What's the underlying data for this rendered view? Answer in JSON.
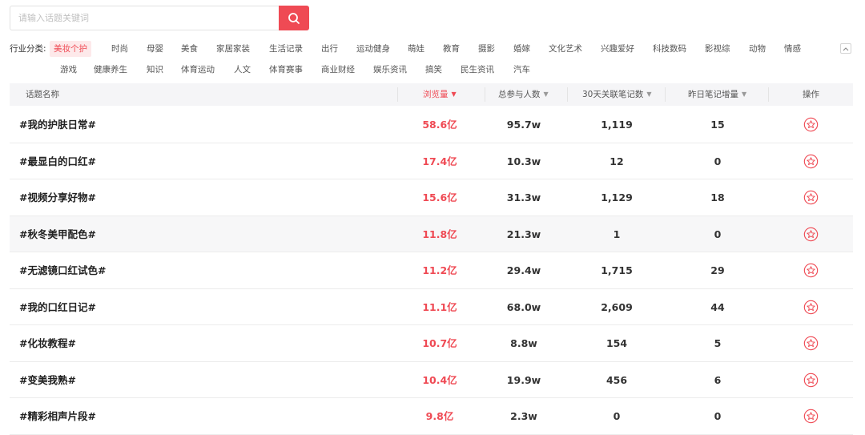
{
  "search": {
    "placeholder": "请输入话题关键词",
    "icon": "search-icon"
  },
  "categories": {
    "label": "行业分类:",
    "row1": [
      "美妆个护",
      "时尚",
      "母婴",
      "美食",
      "家居家装",
      "生活记录",
      "出行",
      "运动健身",
      "萌娃",
      "教育",
      "摄影",
      "婚嫁",
      "文化艺术",
      "兴趣爱好",
      "科技数码",
      "影视综",
      "动物",
      "情感"
    ],
    "row2": [
      "游戏",
      "健康养生",
      "知识",
      "体育运动",
      "人文",
      "体育赛事",
      "商业财经",
      "娱乐资讯",
      "搞笑",
      "民生资讯",
      "汽车"
    ],
    "active": "美妆个护"
  },
  "table": {
    "headers": {
      "name": "话题名称",
      "views": "浏览量",
      "participants": "总参与人数",
      "notes30": "30天关联笔记数",
      "yesterday": "昨日笔记增量",
      "action": "操作"
    },
    "rows": [
      {
        "name": "#我的护肤日常#",
        "views": "58.6亿",
        "participants": "95.7w",
        "notes30": "1,119",
        "yesterday": "15"
      },
      {
        "name": "#最显白的口红#",
        "views": "17.4亿",
        "participants": "10.3w",
        "notes30": "12",
        "yesterday": "0"
      },
      {
        "name": "#视频分享好物#",
        "views": "15.6亿",
        "participants": "31.3w",
        "notes30": "1,129",
        "yesterday": "18"
      },
      {
        "name": "#秋冬美甲配色#",
        "views": "11.8亿",
        "participants": "21.3w",
        "notes30": "1",
        "yesterday": "0"
      },
      {
        "name": "#无滤镜口红试色#",
        "views": "11.2亿",
        "participants": "29.4w",
        "notes30": "1,715",
        "yesterday": "29"
      },
      {
        "name": "#我的口红日记#",
        "views": "11.1亿",
        "participants": "68.0w",
        "notes30": "2,609",
        "yesterday": "44"
      },
      {
        "name": "#化妆教程#",
        "views": "10.7亿",
        "participants": "8.8w",
        "notes30": "154",
        "yesterday": "5"
      },
      {
        "name": "#变美我熟#",
        "views": "10.4亿",
        "participants": "19.9w",
        "notes30": "456",
        "yesterday": "6"
      },
      {
        "name": "#精彩相声片段#",
        "views": "9.8亿",
        "participants": "2.3w",
        "notes30": "0",
        "yesterday": "0"
      }
    ]
  },
  "colors": {
    "accent": "#ef4a54",
    "header_bg": "#f5f5f7",
    "alt_row_bg": "#f7f7f8",
    "active_tag_bg": "#fde9ea"
  }
}
